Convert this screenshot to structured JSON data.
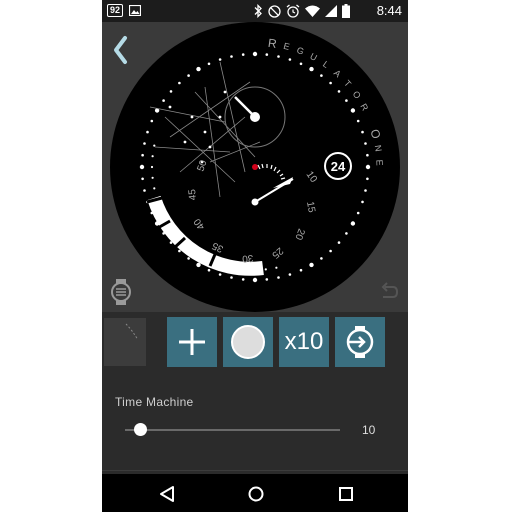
{
  "status_bar": {
    "notification_count": "92",
    "time": "8:44",
    "icons": [
      "image-icon",
      "bluetooth-icon",
      "do-not-disturb-icon",
      "alarm-icon",
      "wifi-icon",
      "cellular-icon",
      "battery-icon"
    ]
  },
  "watch": {
    "brand_text": "REGULATOR ONE",
    "date_value": "24",
    "dial_numbers": [
      "10",
      "15",
      "20",
      "25",
      "30",
      "35",
      "40",
      "45",
      "50"
    ],
    "icons": [
      "back-chevron-icon",
      "watch-list-icon",
      "undo-icon"
    ]
  },
  "controls": {
    "add_label": "+",
    "x10_label": "x10",
    "icons": [
      "plus-icon",
      "circle-icon",
      "watch-enter-icon"
    ],
    "accent_color": "#3a6f80"
  },
  "time_machine": {
    "label": "Time Machine",
    "value": "10",
    "slider_fraction": 0.07
  },
  "nav_bar": {
    "icons": [
      "nav-back-icon",
      "nav-home-icon",
      "nav-recent-icon"
    ]
  }
}
